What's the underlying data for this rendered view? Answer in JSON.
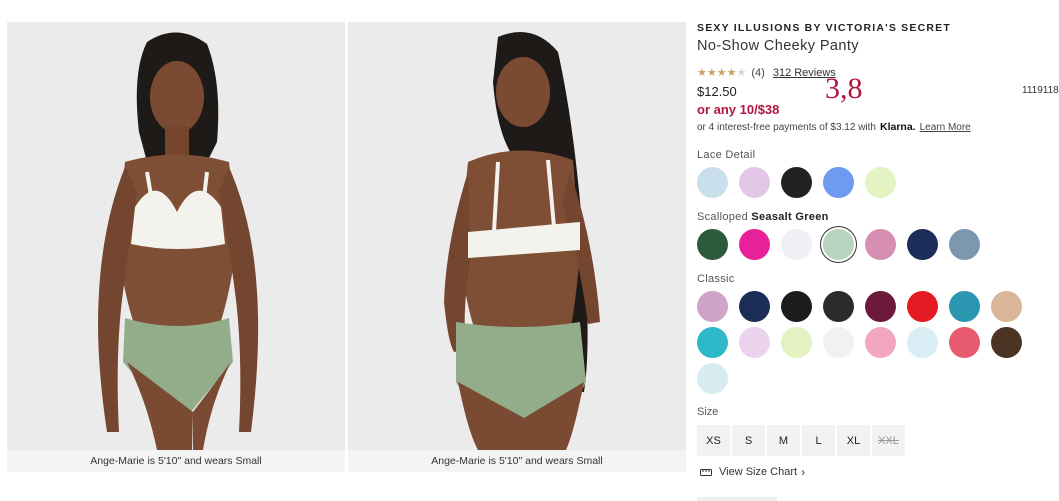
{
  "gallery": {
    "captions": [
      "Ange-Marie is 5'10\" and wears Small",
      "Ange-Marie is 5'10\" and wears Small"
    ]
  },
  "product": {
    "brand": "SEXY ILLUSIONS BY VICTORIA'S SECRET",
    "name": "No-Show Cheeky Panty",
    "rating": 4,
    "rating_max": 5,
    "rating_count": "(4)",
    "reviews_link": "312 Reviews",
    "price": "$12.50",
    "promo": "or any 10/$38",
    "installments_text": "or 4 interest-free payments of $3.12 with",
    "klarna_logo": "Klarna.",
    "learn_more": "Learn More",
    "overlay_number": "3,8",
    "item_number": "1119118"
  },
  "colors": {
    "lace": {
      "label": "Lace Detail",
      "swatches": [
        "#c9e0ec",
        "#e3c7e6",
        "#222222",
        "#6e9af0",
        "#e4f3c2"
      ]
    },
    "scalloped": {
      "label": "Scalloped",
      "selected_name": "Seasalt Green",
      "swatches": [
        "#2c5b3a",
        "#e8219b",
        "#eef0f6",
        "#b8d3c0",
        "#d68fb3",
        "#1e2e5a",
        "#7d98ae"
      ]
    },
    "classic": {
      "label": "Classic",
      "swatches": [
        "#d0a3c8",
        "#1b2c55",
        "#1c1c1c",
        "#2b2b2b",
        "#6d1a3a",
        "#e41a22",
        "#2a96b0",
        "#d9b697",
        "#2fb8c8",
        "#ebd3ee",
        "#e4f1c0",
        "#f1f1f1",
        "#f3a6c2",
        "#d8eef4",
        "#e85a6e",
        "#4b3424",
        "#d7ecf1"
      ]
    }
  },
  "size": {
    "label": "Size",
    "options": [
      "XS",
      "S",
      "M",
      "L",
      "XL",
      "XXL"
    ],
    "unavailable": [
      "XXL"
    ],
    "chart_link": "View Size Chart"
  }
}
